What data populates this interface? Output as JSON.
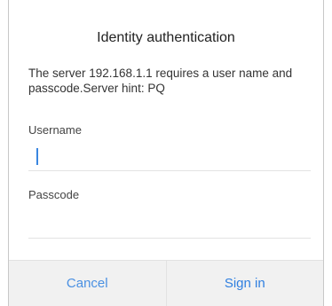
{
  "dialog": {
    "title": "Identity authentication",
    "message": "The server 192.168.1.1 requires a user name and passcode.Server hint: PQ",
    "username_label": "Username",
    "username_value": "",
    "passcode_label": "Passcode",
    "passcode_value": "",
    "cancel_label": "Cancel",
    "signin_label": "Sign in"
  },
  "colors": {
    "accent": "#4a90e2",
    "footer_bg": "#f1f1f1"
  }
}
